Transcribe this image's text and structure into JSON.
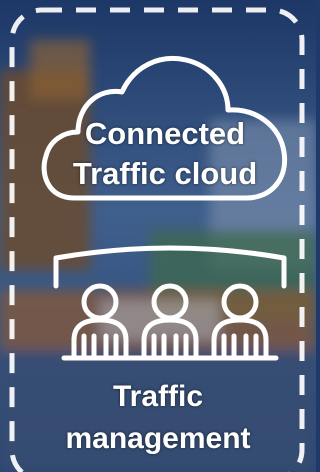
{
  "cloud": {
    "icon": "cloud-icon",
    "label_line1": "Connected",
    "label_line2": "Traffic cloud"
  },
  "management": {
    "icon": "people-at-table-icon",
    "label_line1": "Traffic",
    "label_line2": "management"
  },
  "colors": {
    "frame": "#ffffff",
    "icon_stroke": "#ffffff",
    "text": "#ffffff",
    "backdrop": "#1f3a6a"
  }
}
